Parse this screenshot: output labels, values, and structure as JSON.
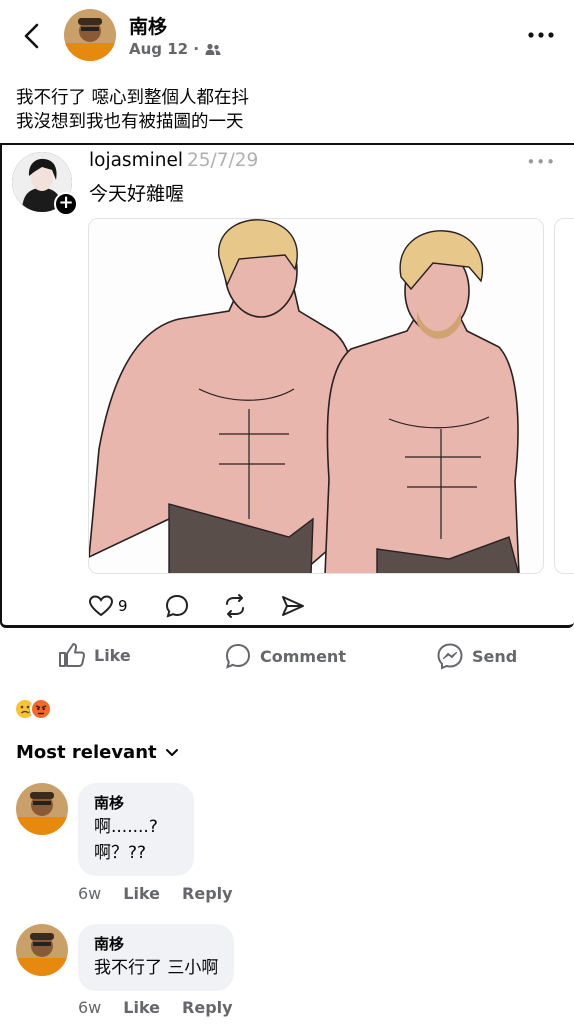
{
  "header": {
    "author": "南栘",
    "date": "Aug 12 ·",
    "audience_icon": "friends-icon",
    "more_icon": "more-icon"
  },
  "caption": {
    "line1": "我不行了 噁心到整個人都在抖",
    "line2": "我沒想到我也有被描圖的一天"
  },
  "shared_post": {
    "username": "lojasminel",
    "date": "25/7/29",
    "text": "今天好雜喔",
    "likes": "9"
  },
  "actions": {
    "like": "Like",
    "comment": "Comment",
    "send": "Send"
  },
  "reactions": [
    "sad",
    "angry"
  ],
  "sort_label": "Most relevant",
  "comments": [
    {
      "name": "南栘",
      "line1": "啊.......?",
      "line2": "啊？??",
      "time": "6w",
      "like": "Like",
      "reply": "Reply"
    },
    {
      "name": "南栘",
      "line1": "我不行了 三小啊",
      "time": "6w",
      "like": "Like",
      "reply": "Reply"
    }
  ],
  "colors": {
    "secondary": "#65676b",
    "bubble": "#f0f2f5",
    "skin": "#e8b6ad"
  }
}
